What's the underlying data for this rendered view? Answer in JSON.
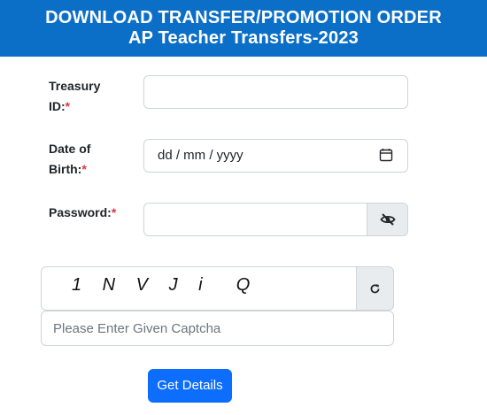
{
  "header": {
    "line1": "DOWNLOAD TRANSFER/PROMOTION ORDER",
    "line2": "AP Teacher Transfers-2023"
  },
  "form": {
    "treasury": {
      "label_line1": "Treasury",
      "label_line2": "ID:",
      "required_mark": "*",
      "value": ""
    },
    "dob": {
      "label_line1": "Date of",
      "label_line2": "Birth:",
      "required_mark": "*",
      "placeholder": "dd / mm / yyyy",
      "icon": "calendar-icon"
    },
    "password": {
      "label": "Password:",
      "required_mark": "*",
      "value": "",
      "toggle_icon": "eye-slash-icon"
    },
    "captcha": {
      "text": "1 N V J i  Q",
      "refresh_icon": "refresh-icon",
      "input_placeholder": "Please Enter Given Captcha"
    },
    "submit_label": "Get Details"
  },
  "colors": {
    "header_bg": "#0b6fc8",
    "primary": "#0d6efd",
    "required": "#dc3545",
    "addon_bg": "#e9ecef",
    "border": "#ced4da"
  }
}
